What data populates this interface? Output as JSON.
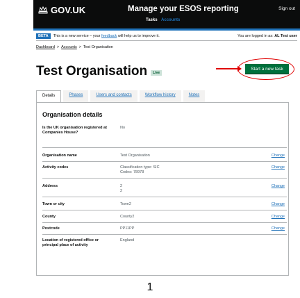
{
  "header": {
    "logo": "GOV.UK",
    "service_name": "Manage your ESOS reporting",
    "sign_out": "Sign out",
    "nav": [
      "Tasks",
      "Accounts"
    ]
  },
  "phase_banner": {
    "tag": "BETA",
    "message_pre": "This is a new service – your",
    "feedback_link": "feedback",
    "message_post": "will help us to improve it.",
    "logged_in_pre": "You are logged in as:",
    "logged_in_user": "AL Test user"
  },
  "breadcrumb": [
    "Dashboard",
    "Accounts",
    "Test Organisation"
  ],
  "page": {
    "title": "Test Organisation",
    "status_tag": "Live",
    "start_button": "Start a new task"
  },
  "tabs": [
    "Details",
    "Phases",
    "Users and contacts",
    "Workflow history",
    "Notes"
  ],
  "details": {
    "heading": "Organisation details",
    "change_label": "Change",
    "rows": [
      {
        "key": "Is the UK organisation registered at Companies House?",
        "value": "No",
        "change": false
      },
      {
        "key": "Organisation name",
        "value": "Test Organisation",
        "change": true
      },
      {
        "key": "Activity codes",
        "value": "Classification type: SIC",
        "value2": "Codes: 78978",
        "change": true
      },
      {
        "key": "Address",
        "value": "2",
        "value2": "2",
        "change": true
      },
      {
        "key": "Town or city",
        "value": "Town2",
        "change": true
      },
      {
        "key": "County",
        "value": "County2",
        "change": true
      },
      {
        "key": "Postcode",
        "value": "PP11PP",
        "change": true
      },
      {
        "key": "Location of registered office or principal place of activity",
        "value": "England",
        "change": false
      }
    ]
  },
  "footer_number": "1",
  "colors": {
    "header_bg": "#0b0c0c",
    "brand_blue": "#1d70b8",
    "button_green": "#00703c",
    "annotation_red": "#e00000"
  }
}
